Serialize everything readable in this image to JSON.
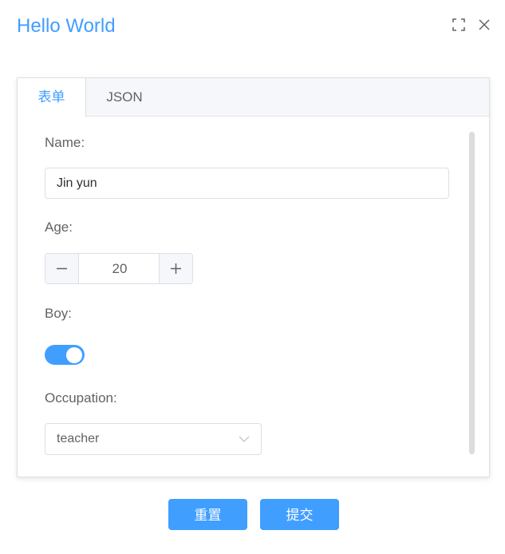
{
  "dialog": {
    "title": "Hello World"
  },
  "header_icons": {
    "fullscreen": "fullscreen-icon",
    "close": "close-icon"
  },
  "tabs": [
    {
      "label": "表单",
      "active": true
    },
    {
      "label": "JSON",
      "active": false
    }
  ],
  "form": {
    "name": {
      "label": "Name:",
      "value": "Jin yun"
    },
    "age": {
      "label": "Age:",
      "value": "20"
    },
    "boy": {
      "label": "Boy:",
      "checked": true
    },
    "occupation": {
      "label": "Occupation:",
      "value": "teacher"
    }
  },
  "buttons": {
    "reset": "重置",
    "submit": "提交"
  },
  "colors": {
    "accent": "#409eff",
    "text": "#606266",
    "border": "#dcdfe6"
  }
}
